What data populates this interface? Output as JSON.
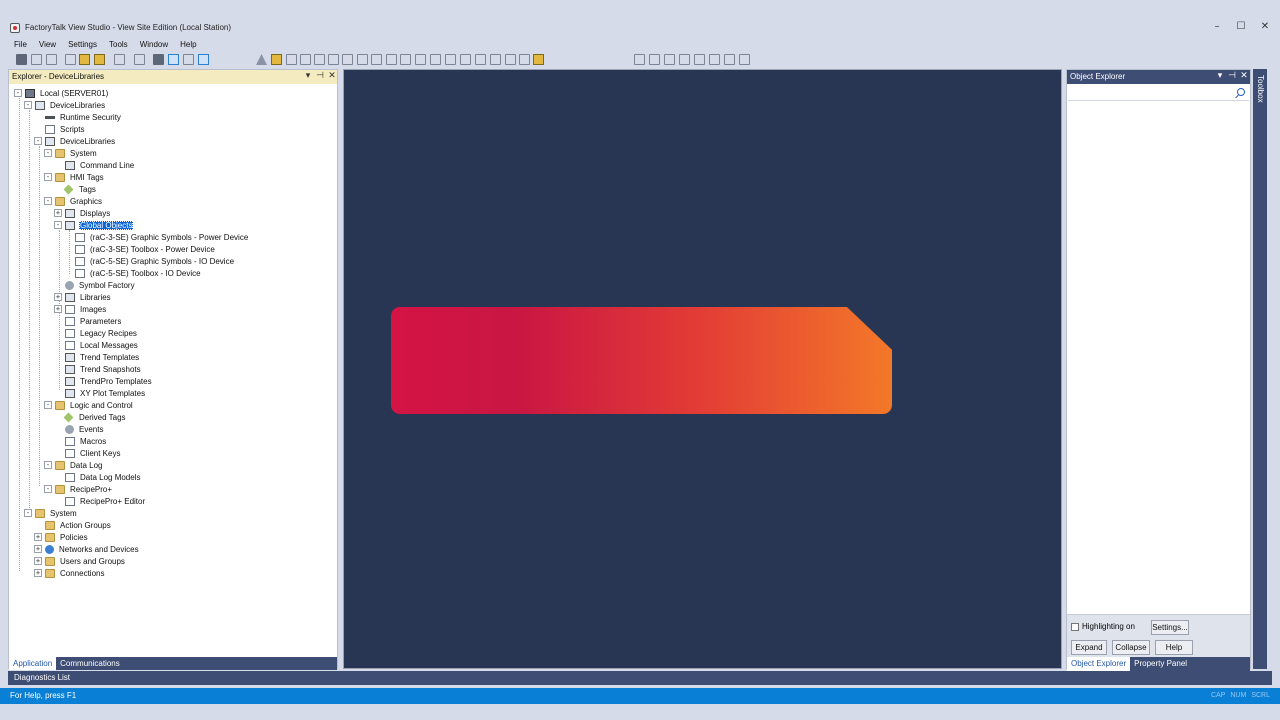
{
  "window": {
    "title": "FactoryTalk View Studio - View Site Edition (Local Station)",
    "minimize": "–",
    "maximize": "☐",
    "close": "✕"
  },
  "menu": [
    "File",
    "View",
    "Settings",
    "Tools",
    "Window",
    "Help"
  ],
  "explorer": {
    "title": "Explorer - DeviceLibraries",
    "pin": "⊣",
    "dropdown": "▾",
    "close": "✕",
    "tree": {
      "root": "Local (SERVER01)",
      "app": "DeviceLibraries",
      "runtime_security": "Runtime Security",
      "scripts": "Scripts",
      "area": "DeviceLibraries",
      "system": "System",
      "command_line": "Command Line",
      "hmi_tags": "HMI Tags",
      "tags": "Tags",
      "graphics": "Graphics",
      "displays": "Displays",
      "global_objects": "Global Objects",
      "go1": "(raC-3-SE) Graphic Symbols - Power Device",
      "go2": "(raC-3-SE) Toolbox - Power Device",
      "go3": "(raC-5-SE) Graphic Symbols - IO Device",
      "go4": "(raC-5-SE) Toolbox - IO Device",
      "symbol_factory": "Symbol Factory",
      "libraries": "Libraries",
      "images": "Images",
      "parameters": "Parameters",
      "legacy_recipes": "Legacy Recipes",
      "local_messages": "Local Messages",
      "trend_templates": "Trend Templates",
      "trend_snapshots": "Trend Snapshots",
      "trendpro_templates": "TrendPro Templates",
      "xy_plot_templates": "XY Plot Templates",
      "logic_control": "Logic and Control",
      "derived_tags": "Derived Tags",
      "events": "Events",
      "macros": "Macros",
      "client_keys": "Client Keys",
      "data_log": "Data Log",
      "data_log_models": "Data Log Models",
      "recipepro": "RecipePro+",
      "recipepro_editor": "RecipePro+ Editor",
      "system_root": "System",
      "action_groups": "Action Groups",
      "policies": "Policies",
      "networks_devices": "Networks and Devices",
      "users_groups": "Users and Groups",
      "connections": "Connections"
    },
    "tabs": [
      "Application",
      "Communications"
    ]
  },
  "object_explorer": {
    "title": "Object Explorer",
    "search_placeholder": "",
    "highlighting": "Highlighting on",
    "settings": "Settings...",
    "expand": "Expand",
    "collapse": "Collapse",
    "help": "Help",
    "tabs": [
      "Object Explorer",
      "Property Panel"
    ]
  },
  "toolbox": "Toolbox",
  "diagnostics": "Diagnostics List",
  "status": {
    "text": "For Help, press F1",
    "indicators": [
      "CAP",
      "NUM",
      "SCRL"
    ]
  },
  "colors": {
    "canvas": "#283654",
    "banner_start": "#d41444",
    "banner_end": "#f37828",
    "status_bar": "#0a7fd6",
    "panel_dark": "#3d4d73"
  }
}
